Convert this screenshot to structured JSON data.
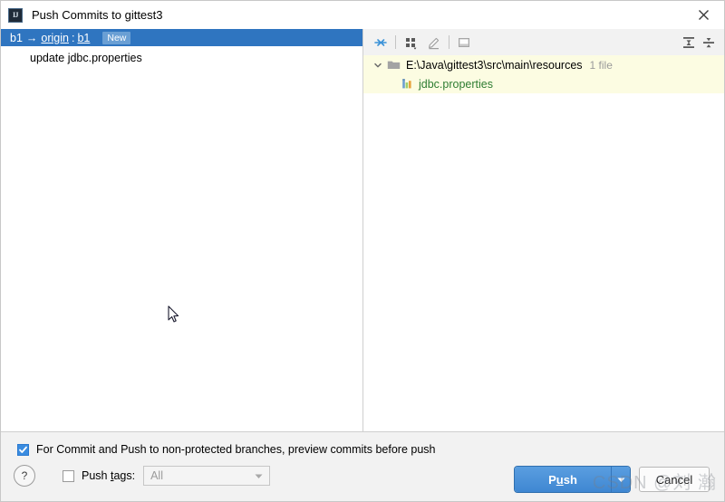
{
  "window": {
    "title": "Push Commits to gittest3",
    "app_icon": "intellij-idea-icon",
    "close_icon": "close-icon"
  },
  "commits_panel": {
    "branch_source": "b1",
    "arrow": "→",
    "remote": "origin",
    "colon": ":",
    "branch_target": "b1",
    "status_badge": "New",
    "commits": [
      {
        "message": "update jdbc.properties"
      }
    ]
  },
  "changes_panel": {
    "toolbar": [
      {
        "name": "show-diff-icon",
        "title": "Show Diff",
        "enabled": true
      },
      {
        "name": "group-by-icon",
        "title": "Group By",
        "enabled": true
      },
      {
        "name": "edit-source-icon",
        "title": "Edit Source",
        "enabled": false
      },
      {
        "name": "preview-diff-icon",
        "title": "Preview Diff",
        "enabled": false
      },
      {
        "name": "expand-all-icon",
        "title": "Expand All",
        "enabled": true
      },
      {
        "name": "collapse-all-icon",
        "title": "Collapse All",
        "enabled": true
      }
    ],
    "tree": {
      "directory": {
        "path": "E:\\Java\\gittest3\\src\\main\\resources",
        "file_count": "1 file",
        "expanded": true,
        "folder_icon": "folder-icon",
        "chevron_icon": "chevron-down-icon"
      },
      "files": [
        {
          "name": "jdbc.properties",
          "icon": "properties-file-icon",
          "status_color": "#2e7d32"
        }
      ]
    }
  },
  "footer": {
    "preview_option": {
      "label": "For Commit and Push to non-protected branches, preview commits before push",
      "checked": true
    },
    "help_label": "?",
    "push_tags": {
      "label_prefix": "Push ",
      "label_mnemonic": "t",
      "label_suffix": "ags:",
      "checked": false,
      "value": "All",
      "enabled": false,
      "dropdown_icon": "chevron-down-icon"
    },
    "push_button": {
      "prefix": "P",
      "mnemonic": "u",
      "suffix": "sh",
      "label": "Push",
      "dropdown_icon": "chevron-down-icon"
    },
    "cancel_button": {
      "label": "Cancel"
    }
  },
  "watermark": {
    "text": "CSDN @刘 瀚"
  },
  "colors": {
    "selection_blue": "#2f75c0",
    "tree_highlight": "#fcfce2",
    "accent_button": "#4a90d9",
    "new_file_green": "#2e7d32",
    "toolbar_bg": "#f2f2f2"
  }
}
